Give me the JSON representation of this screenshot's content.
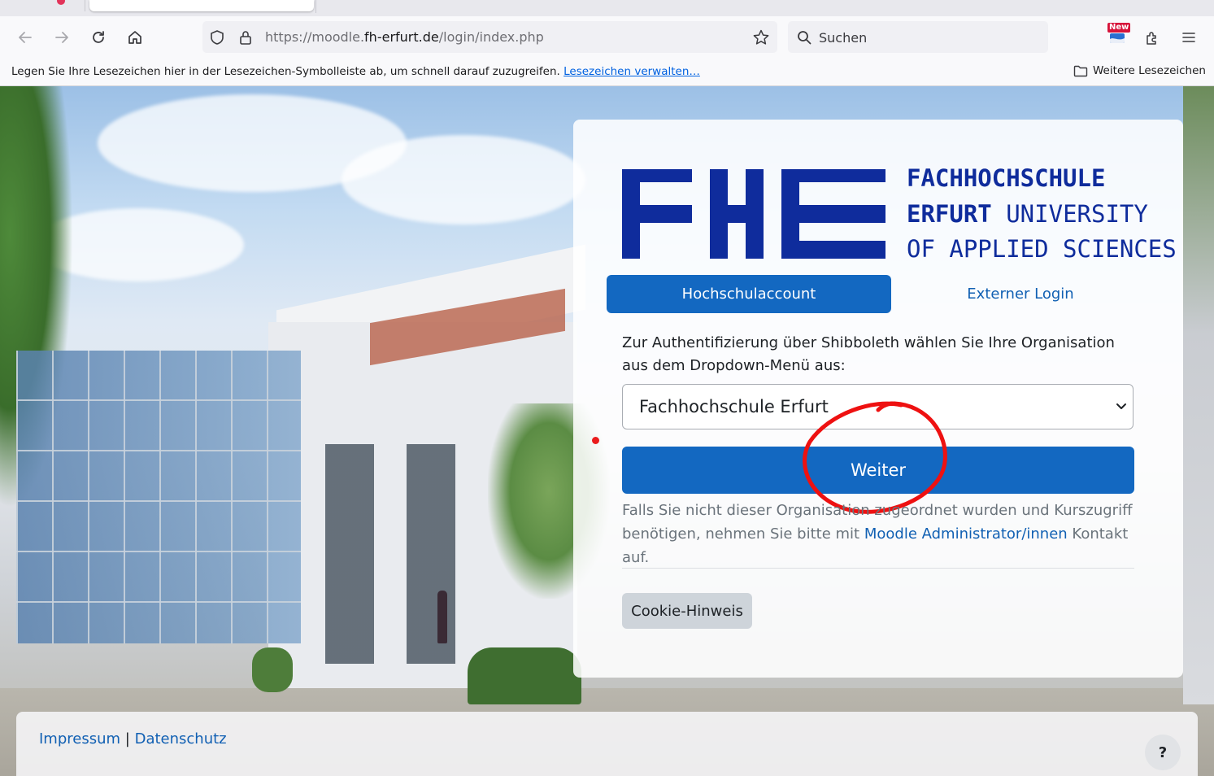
{
  "browser": {
    "url_prefix": "https://moodle.",
    "url_host": "fh-erfurt.de",
    "url_path": "/login/index.php",
    "search_placeholder": "Suchen",
    "new_badge": "New",
    "bookmarks_hint": "Legen Sie Ihre Lesezeichen hier in der Lesezeichen-Symbolleiste ab, um schnell darauf zuzugreifen.",
    "bookmarks_manage": "Lesezeichen verwalten…",
    "bookmarks_more": "Weitere Lesezeichen"
  },
  "logo": {
    "line1": "FACHHOCHSCHULE",
    "line2_bold": "ERFURT",
    "line2_rest": " UNIVERSITY",
    "line3": "OF APPLIED SCIENCES",
    "brand_color": "#0f2c9c"
  },
  "login": {
    "tab_primary": "Hochschulaccount",
    "tab_secondary": "Externer Login",
    "instruction": "Zur Authentifizierung über Shibboleth wählen Sie Ihre Organisation aus dem Dropdown-Menü aus:",
    "selected_org": "Fachhochschule Erfurt",
    "submit": "Weiter",
    "note_before": "Falls Sie nicht dieser Organisation zugeordnet wurden und Kurszugriff benötigen, nehmen Sie bitte mit ",
    "note_link": "Moodle Administrator/innen",
    "note_after": " Kontakt auf.",
    "cookie": "Cookie-Hinweis",
    "accent_color": "#1368c1"
  },
  "footer": {
    "impressum": "Impressum",
    "separator": "|",
    "datenschutz": "Datenschutz",
    "help": "?"
  }
}
